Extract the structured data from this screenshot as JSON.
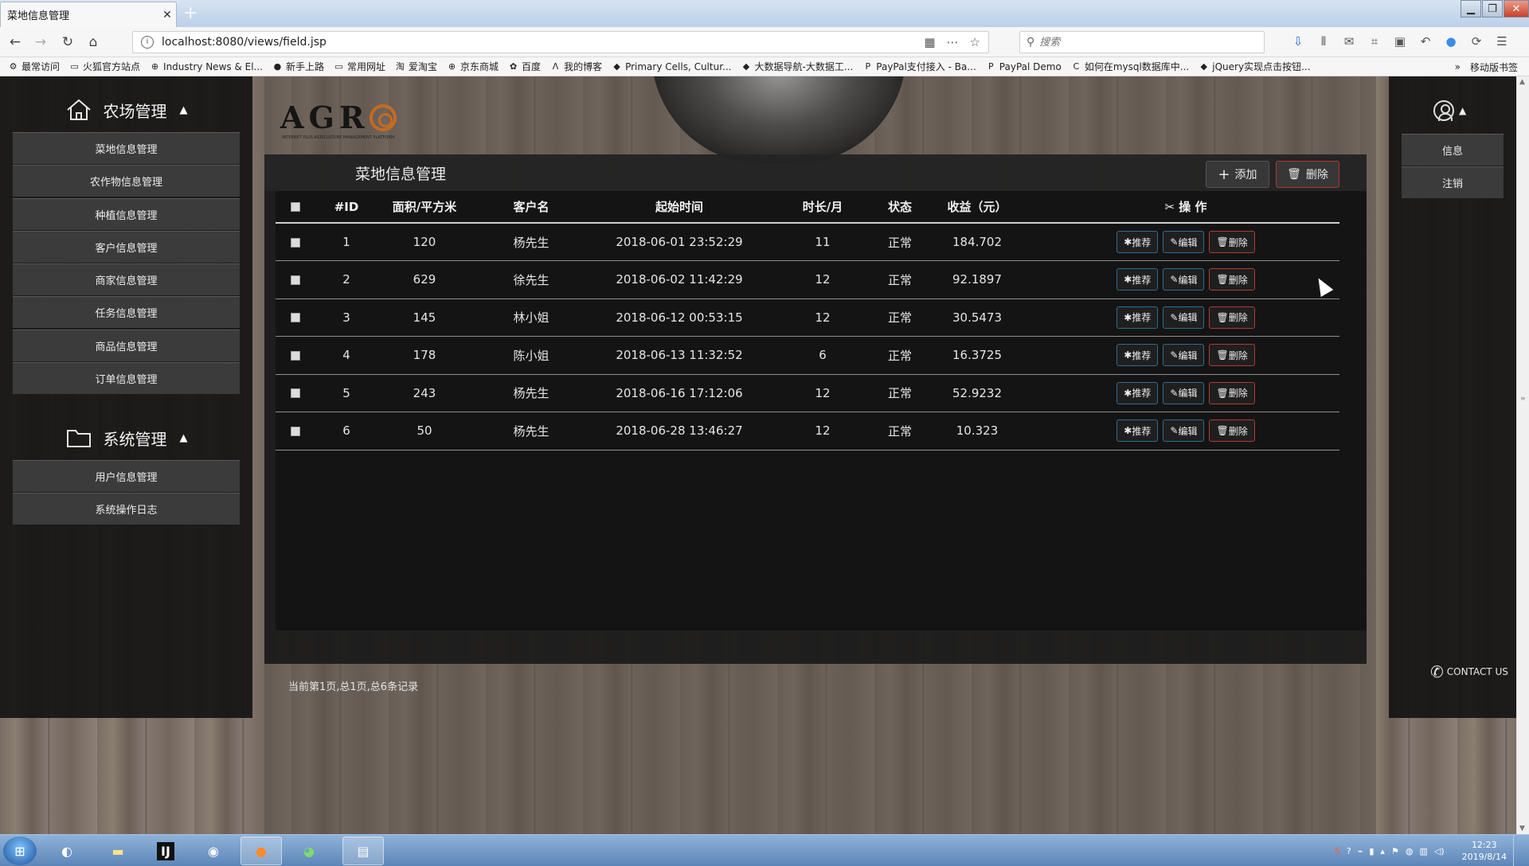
{
  "browser": {
    "tab_title": "菜地信息管理",
    "tab_close": "✕",
    "new_tab": "+",
    "url": "localhost:8080/views/field.jsp",
    "search_placeholder": "搜索",
    "bookmarks": [
      {
        "label": "最常访问",
        "icon": "gear-icon"
      },
      {
        "label": "火狐官方站点",
        "icon": "folder-icon"
      },
      {
        "label": "Industry News & El...",
        "icon": "globe-icon"
      },
      {
        "label": "新手上路",
        "icon": "firefox-icon"
      },
      {
        "label": "常用网址",
        "icon": "folder-icon"
      },
      {
        "label": "爱淘宝",
        "icon": "taobao-icon"
      },
      {
        "label": "京东商城",
        "icon": "globe-icon"
      },
      {
        "label": "百度",
        "icon": "baidu-icon"
      },
      {
        "label": "我的博客",
        "icon": "blog-icon"
      },
      {
        "label": "Primary Cells, Cultur...",
        "icon": "site-icon"
      },
      {
        "label": "大数据导航-大数据工...",
        "icon": "site-icon"
      },
      {
        "label": "PayPal支付接入 - Ba...",
        "icon": "paypal-icon"
      },
      {
        "label": "PayPal Demo",
        "icon": "paypal-icon"
      },
      {
        "label": "如何在mysql数据库中...",
        "icon": "csdn-icon"
      },
      {
        "label": "jQuery实现点击按钮...",
        "icon": "site-icon"
      }
    ],
    "bookmarks_overflow": "»",
    "mobile_bookmarks": "移动版书签"
  },
  "sidebar": {
    "farm_title": "农场管理",
    "farm_items": [
      "菜地信息管理",
      "农作物信息管理",
      "种植信息管理",
      "客户信息管理",
      "商家信息管理",
      "任务信息管理",
      "商品信息管理",
      "订单信息管理"
    ],
    "system_title": "系统管理",
    "system_items": [
      "用户信息管理",
      "系统操作日志"
    ]
  },
  "right_panel": {
    "items": [
      "信息",
      "注销"
    ],
    "contact": "CONTACT US"
  },
  "logo": {
    "letters": [
      "A",
      "G",
      "R"
    ],
    "tagline": "INTERNET PLUS AGRICULTURE MANAGEMENT PLATFORM"
  },
  "panel": {
    "title": "菜地信息管理",
    "add_label": "添加",
    "delete_label": "删除",
    "columns": [
      "#ID",
      "面积/平方米",
      "客户名",
      "起始时间",
      "时长/月",
      "状态",
      "收益（元）",
      "操 作"
    ],
    "rows": [
      [
        "1",
        "120",
        "杨先生",
        "2018-06-01 23:52:29",
        "11",
        "正常",
        "184.702"
      ],
      [
        "2",
        "629",
        "徐先生",
        "2018-06-02 11:42:29",
        "12",
        "正常",
        "92.1897"
      ],
      [
        "3",
        "145",
        "林小姐",
        "2018-06-12 00:53:15",
        "12",
        "正常",
        "30.5473"
      ],
      [
        "4",
        "178",
        "陈小姐",
        "2018-06-13 11:32:52",
        "6",
        "正常",
        "16.3725"
      ],
      [
        "5",
        "243",
        "杨先生",
        "2018-06-16 17:12:06",
        "12",
        "正常",
        "52.9232"
      ],
      [
        "6",
        "50",
        "杨先生",
        "2018-06-28 13:46:27",
        "12",
        "正常",
        "10.323"
      ]
    ],
    "row_actions": {
      "recommend": "推荐",
      "edit": "编辑",
      "delete": "删除"
    },
    "pager": "当前第1页,总1页,总6条记录"
  },
  "taskbar": {
    "time": "12:23",
    "date": "2019/8/14"
  }
}
